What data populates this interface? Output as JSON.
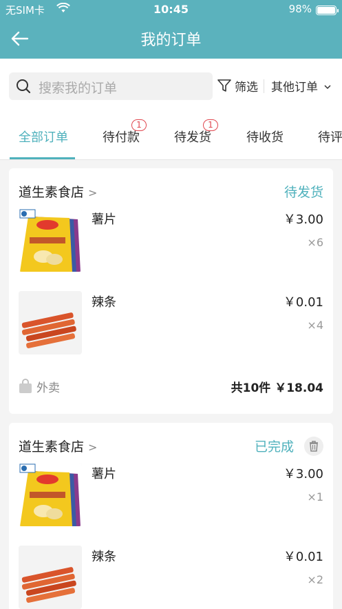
{
  "status_bar": {
    "carrier": "无SIM卡",
    "time": "10:45",
    "battery": "98%",
    "wifi_icon": "wifi-icon"
  },
  "nav": {
    "title": "我的订单",
    "back_icon": "arrow-left-icon"
  },
  "search": {
    "placeholder": "搜索我的订单",
    "filter_label": "筛选",
    "other_orders_label": "其他订单"
  },
  "tabs": [
    {
      "label": "全部订单",
      "active": true,
      "badge": ""
    },
    {
      "label": "待付款",
      "active": false,
      "badge": "1"
    },
    {
      "label": "待发货",
      "active": false,
      "badge": "1"
    },
    {
      "label": "待收货",
      "active": false,
      "badge": ""
    },
    {
      "label": "待评",
      "active": false,
      "badge": ""
    }
  ],
  "orders": [
    {
      "shop": "道生素食店",
      "status": "待发货",
      "items": [
        {
          "name": "薯片",
          "price": "￥3.00",
          "qty": "×6",
          "thumb": "chips-bag"
        },
        {
          "name": "辣条",
          "price": "￥0.01",
          "qty": "×4",
          "thumb": "spicy-strips"
        }
      ],
      "delivery": "外卖",
      "summary": "共10件 ￥18.04"
    },
    {
      "shop": "道生素食店",
      "status": "已完成",
      "items": [
        {
          "name": "薯片",
          "price": "￥3.00",
          "qty": "×1",
          "thumb": "chips-bag"
        },
        {
          "name": "辣条",
          "price": "￥0.01",
          "qty": "×2",
          "thumb": "spicy-strips"
        }
      ]
    }
  ],
  "colors": {
    "header": "#5bb2bd",
    "accent": "#4fb1bc",
    "badge": "#e0474f"
  }
}
